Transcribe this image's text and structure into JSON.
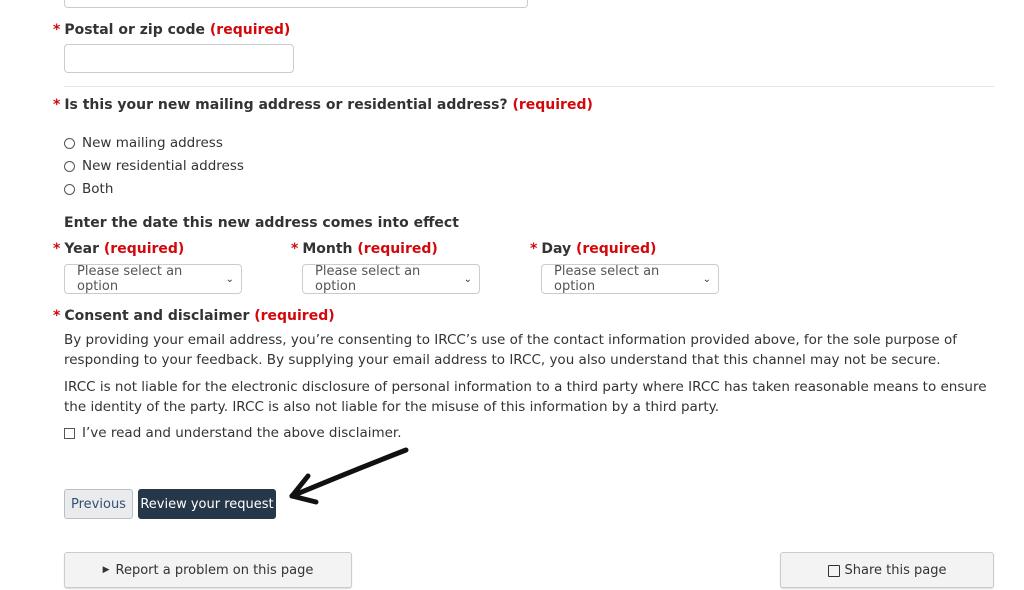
{
  "postal": {
    "label": "Postal or zip code",
    "required": "(required)",
    "value": ""
  },
  "address_type": {
    "question": "Is this your new mailing address or residential address?",
    "required": "(required)",
    "options": [
      "New mailing address",
      "New residential address",
      "Both"
    ]
  },
  "effective_date": {
    "heading": "Enter the date this new address comes into effect",
    "year": {
      "label": "Year",
      "required": "(required)",
      "placeholder": "Please select an option"
    },
    "month": {
      "label": "Month",
      "required": "(required)",
      "placeholder": "Please select an option"
    },
    "day": {
      "label": "Day",
      "required": "(required)",
      "placeholder": "Please select an option"
    }
  },
  "consent": {
    "label": "Consent and disclaimer",
    "required": "(required)",
    "paragraph1": "By providing your email address, you’re consenting to IRCC’s use of the contact information provided above, for the sole purpose of responding to your feedback. By supplying your email address to IRCC, you also understand that this channel may not be secure.",
    "paragraph2": "IRCC is not liable for the electronic disclosure of personal information to a third party where IRCC has taken reasonable means to ensure the identity of the party. IRCC is also not liable for the misuse of this information by a third party.",
    "checkbox_label": "I’ve read and understand the above disclaimer."
  },
  "actions": {
    "previous": "Previous",
    "review": "Review your request"
  },
  "footer": {
    "report": "Report a problem on this page",
    "share": "Share this page"
  },
  "required_marker": "*"
}
